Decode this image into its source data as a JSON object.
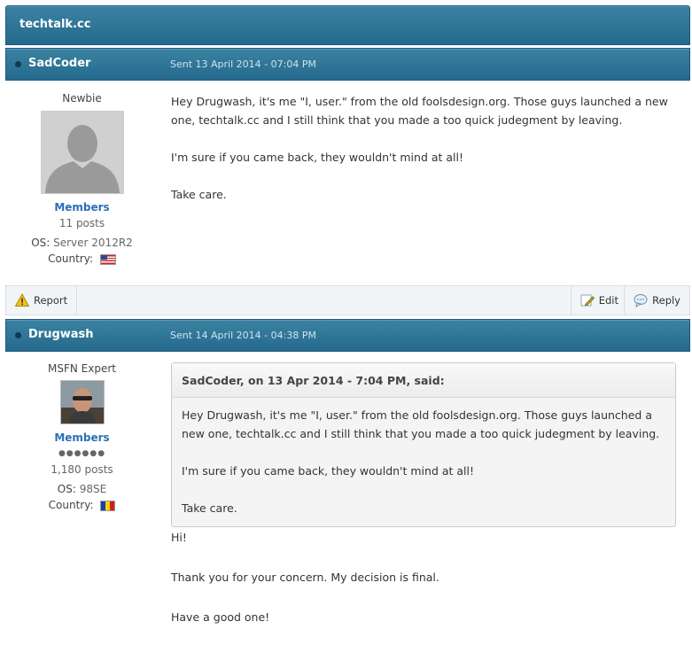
{
  "site": {
    "title": "techtalk.cc"
  },
  "posts": [
    {
      "author": "SadCoder",
      "date": "Sent 13 April 2014 - 07:04 PM",
      "rank": "Newbie",
      "group": "Members",
      "post_count": "11 posts",
      "os_label": "OS:",
      "os_value": "Server 2012R2",
      "country_label": "Country:",
      "paragraphs": [
        "Hey Drugwash, it's me \"I, user.\" from the old foolsdesign.org. Those guys launched a new one, techtalk.cc and I still think that you made a too quick judegment by leaving.",
        "I'm sure if you came back, they wouldn't mind at all!",
        "Take care."
      ]
    },
    {
      "author": "Drugwash",
      "date": "Sent 14 April 2014 - 04:38 PM",
      "rank": "MSFN Expert",
      "group": "Members",
      "pips": "●●●●●●",
      "post_count": "1,180 posts",
      "os_label": "OS:",
      "os_value": "98SE",
      "country_label": "Country:",
      "quote": {
        "header": "SadCoder, on 13 Apr 2014 - 7:04 PM, said:",
        "paragraphs": [
          "Hey Drugwash, it's me \"I, user.\" from the old foolsdesign.org. Those guys launched a new one, techtalk.cc and I still think that you made a too quick judegment by leaving.",
          "I'm sure if you came back, they wouldn't mind at all!",
          "Take care."
        ]
      },
      "paragraphs": [
        "Hi!",
        "Thank you for your concern. My decision is final.",
        "Have a good one!"
      ]
    }
  ],
  "toolbar": {
    "report_label": "Report",
    "edit_label": "Edit",
    "reply_label": "Reply"
  },
  "colors": {
    "header_bar": "#2f7799",
    "group_link": "#2a6fb7",
    "quote_bg": "#f4f4f4"
  }
}
